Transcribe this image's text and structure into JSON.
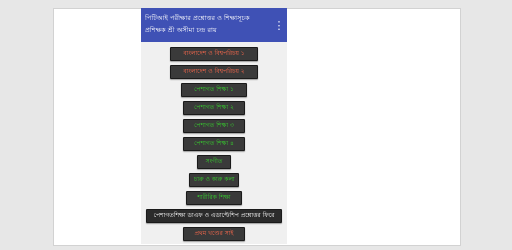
{
  "app": {
    "title_line1": "পিটিআই পরীক্ষার প্রশ্নোত্তর ও শিক্ষাসূচক",
    "title_line2": "প্রশিক্ষক শ্রী অসীমা চন্দ্র রায়"
  },
  "buttons": [
    {
      "label": "বাংলাদেশ ও বিশ্বপরিচয় ১",
      "color": "red"
    },
    {
      "label": "বাংলাদেশ ও বিশ্বপরিচয় ২",
      "color": "red"
    },
    {
      "label": "পেশাগত শিক্ষা ১",
      "color": "green"
    },
    {
      "label": "পেশাগত শিক্ষা ২",
      "color": "green"
    },
    {
      "label": "পেশাগত শিক্ষা ৩",
      "color": "green"
    },
    {
      "label": "পেশাগত শিক্ষা ৪",
      "color": "green"
    },
    {
      "label": "সংগীত",
      "color": "green"
    },
    {
      "label": "চারু ও কারু কলা",
      "color": "green"
    },
    {
      "label": "শারীরিক শিক্ষা",
      "color": "green"
    },
    {
      "label": "পেশাগতশিক্ষা ডাএফ ও এডাপ্টেশিপ প্রশ্নোত্তর ফিরে",
      "color": "white"
    },
    {
      "label": "প্রথম খণ্ডের সাই",
      "color": "red"
    }
  ],
  "colors": {
    "appbar": "#3f51b5",
    "button_green_text": "#37d12e",
    "button_red_text": "#ff6a4d",
    "button_bg": "#3a3a3a"
  },
  "icons": {
    "menu": "more-vert-icon"
  }
}
